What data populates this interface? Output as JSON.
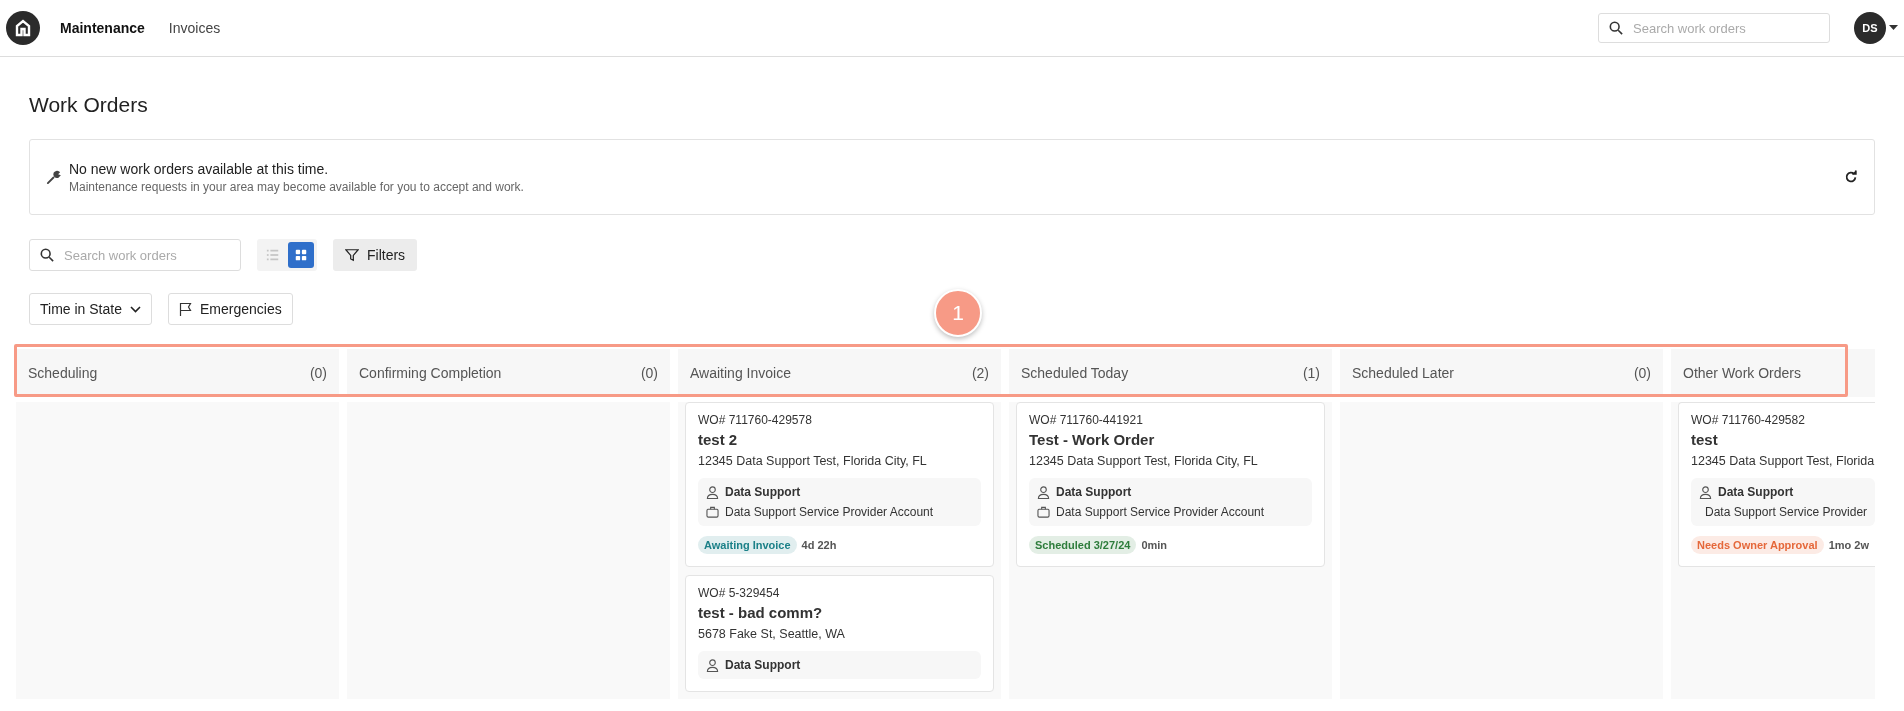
{
  "nav": {
    "links": [
      {
        "label": "Maintenance",
        "selected": true
      },
      {
        "label": "Invoices",
        "selected": false
      }
    ],
    "search": {
      "placeholder": "Search work orders"
    },
    "avatar": "DS"
  },
  "page_title": "Work Orders",
  "notice": {
    "title": "No new work orders available at this time.",
    "text": "Maintenance requests in your area may become available for you to accept and work."
  },
  "toolbar": {
    "search": {
      "placeholder": "Search work orders"
    },
    "views": [
      {
        "kind": "list",
        "selected": false
      },
      {
        "kind": "grid",
        "selected": true
      }
    ],
    "filters": "Filters"
  },
  "sort": {
    "label": "Time in State"
  },
  "emergencies": "Emergencies",
  "callout": "1",
  "columns": [
    {
      "name": "Scheduling",
      "count": "(0)"
    },
    {
      "name": "Confirming Completion",
      "count": "(0)"
    },
    {
      "name": "Awaiting Invoice",
      "count": "(2)",
      "cards": [
        {
          "wo": "WO# 711760-429578",
          "title": "test 2",
          "address": "12345 Data Support Test, Florida City, FL",
          "contact": "Data Support",
          "account": "Data Support Service Provider Account",
          "status": {
            "label": "Awaiting Invoice",
            "color": "#1b8088"
          },
          "age": "4d 22h"
        },
        {
          "wo": "WO# 5-329454",
          "title": "test - bad comm?",
          "address": "5678 Fake St, Seattle, WA",
          "contact": "Data Support"
        }
      ]
    },
    {
      "name": "Scheduled Today",
      "count": "(1)",
      "cards": [
        {
          "wo": "WO# 711760-441921",
          "title": "Test - Work Order",
          "address": "12345 Data Support Test, Florida City, FL",
          "contact": "Data Support",
          "account": "Data Support Service Provider Account",
          "status": {
            "label": "Scheduled 3/27/24",
            "color": "#2e7d3c"
          },
          "age": "0min"
        }
      ]
    },
    {
      "name": "Scheduled Later",
      "count": "(0)"
    },
    {
      "name": "Other Work Orders",
      "cards": [
        {
          "wo": "WO# 711760-429582",
          "title": "test",
          "address": "12345 Data Support Test, Florida",
          "contact": "Data Support",
          "account": "Data Support Service Provider",
          "status": {
            "label": "Needs Owner Approval",
            "color": "#e5683a"
          },
          "age": "1mo 2w"
        }
      ]
    }
  ]
}
